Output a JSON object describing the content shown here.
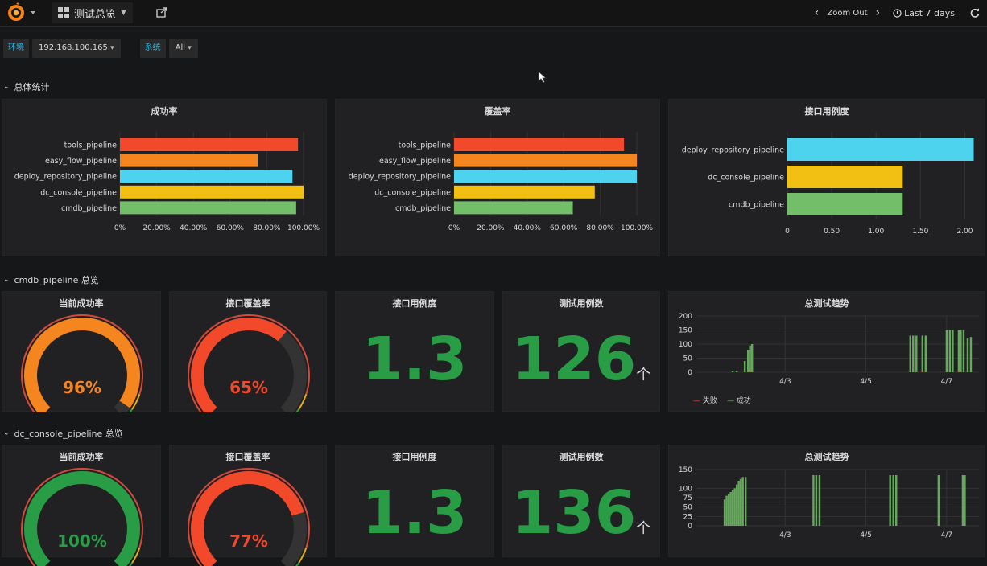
{
  "topbar": {
    "dashboard_title": "测试总览",
    "zoom_out_label": "Zoom Out",
    "time_range_label": "Last 7 days"
  },
  "variables": [
    {
      "label": "环境",
      "value": "192.168.100.165"
    },
    {
      "label": "系统",
      "value": "All"
    }
  ],
  "rows": [
    {
      "title": "总体统计"
    },
    {
      "title": "cmdb_pipeline 总览"
    },
    {
      "title": "dc_console_pipeline 总览"
    }
  ],
  "colors": {
    "red": "#f2492b",
    "orange": "#f5861f",
    "cyan": "#4dd3ee",
    "yellow": "#f2c012",
    "green": "#73bf69",
    "stat_green": "#299c46",
    "text_blue": "#33b5e5"
  },
  "bar_panels": [
    {
      "title": "成功率",
      "chart_data": {
        "type": "bar",
        "orientation": "horizontal",
        "categories": [
          "tools_pipeline",
          "easy_flow_pipeline",
          "deploy_repository_pipeline",
          "dc_console_pipeline",
          "cmdb_pipeline"
        ],
        "values": [
          97,
          75,
          94,
          100,
          96
        ],
        "colors": [
          "#f2492b",
          "#f5861f",
          "#4dd3ee",
          "#f2c012",
          "#73bf69"
        ],
        "xticks": [
          "0%",
          "20.00%",
          "40.00%",
          "60.00%",
          "80.00%",
          "100.00%"
        ],
        "xlim": [
          0,
          100
        ]
      }
    },
    {
      "title": "覆盖率",
      "chart_data": {
        "type": "bar",
        "orientation": "horizontal",
        "categories": [
          "tools_pipeline",
          "easy_flow_pipeline",
          "deploy_repository_pipeline",
          "dc_console_pipeline",
          "cmdb_pipeline"
        ],
        "values": [
          93,
          100,
          100,
          77,
          65
        ],
        "colors": [
          "#f2492b",
          "#f5861f",
          "#4dd3ee",
          "#f2c012",
          "#73bf69"
        ],
        "xticks": [
          "0%",
          "20.00%",
          "40.00%",
          "60.00%",
          "80.00%",
          "100.00%"
        ],
        "xlim": [
          0,
          100
        ]
      }
    },
    {
      "title": "接口用例度",
      "chart_data": {
        "type": "bar",
        "orientation": "horizontal",
        "categories": [
          "deploy_repository_pipeline",
          "dc_console_pipeline",
          "cmdb_pipeline"
        ],
        "values": [
          2.1,
          1.3,
          1.3
        ],
        "colors": [
          "#4dd3ee",
          "#f2c012",
          "#73bf69"
        ],
        "xticks": [
          "0",
          "0.50",
          "1.00",
          "1.50",
          "2.00"
        ],
        "xlim": [
          0,
          2.15
        ]
      }
    }
  ],
  "pipelines": [
    {
      "gauge1_title": "当前成功率",
      "gauge1_value": 96,
      "gauge1_text": "96%",
      "gauge1_color": "#f5861f",
      "gauge2_title": "接口覆盖率",
      "gauge2_value": 65,
      "gauge2_text": "65%",
      "gauge2_color": "#f2492b",
      "stat1_title": "接口用例度",
      "stat1_value": "1.3",
      "stat2_title": "测试用例数",
      "stat2_value": "126",
      "stat2_unit": "个",
      "trend_title": "总测试趋势",
      "trend_legend": [
        "失败",
        "成功"
      ],
      "chart_data": {
        "type": "bar",
        "yticks": [
          "200",
          "150",
          "100",
          "50",
          "0"
        ],
        "ylim": [
          0,
          200
        ],
        "xticks": [
          "4/3",
          "4/5",
          "4/7"
        ],
        "x_domain": [
          0,
          7
        ],
        "xtick_positions": [
          2.2,
          4.2,
          6.2
        ],
        "series": [
          {
            "name": "成功",
            "color": "#73bf69",
            "points": [
              [
                0.9,
                4
              ],
              [
                1.0,
                5
              ],
              [
                1.2,
                40
              ],
              [
                1.28,
                80
              ],
              [
                1.33,
                95
              ],
              [
                1.38,
                100
              ],
              [
                5.3,
                130
              ],
              [
                5.37,
                130
              ],
              [
                5.45,
                130
              ],
              [
                5.6,
                130
              ],
              [
                5.68,
                130
              ],
              [
                6.2,
                150
              ],
              [
                6.28,
                150
              ],
              [
                6.35,
                150
              ],
              [
                6.5,
                150
              ],
              [
                6.55,
                150
              ],
              [
                6.62,
                150
              ],
              [
                6.72,
                120
              ],
              [
                6.8,
                125
              ]
            ]
          },
          {
            "name": "失败",
            "color": "#f2492b",
            "points": [
              [
                1.33,
                2
              ],
              [
                5.6,
                2
              ],
              [
                6.5,
                2
              ]
            ]
          }
        ]
      }
    },
    {
      "gauge1_title": "当前成功率",
      "gauge1_value": 100,
      "gauge1_text": "100%",
      "gauge1_color": "#299c46",
      "gauge2_title": "接口覆盖率",
      "gauge2_value": 77,
      "gauge2_text": "77%",
      "gauge2_color": "#f2492b",
      "stat1_title": "接口用例度",
      "stat1_value": "1.3",
      "stat2_title": "测试用例数",
      "stat2_value": "136",
      "stat2_unit": "个",
      "trend_title": "总测试趋势",
      "chart_data": {
        "type": "bar",
        "yticks": [
          "150",
          "100",
          "75",
          "50",
          "25",
          "0"
        ],
        "ylim": [
          0,
          150
        ],
        "xticks": [
          "4/3",
          "4/5",
          "4/7"
        ],
        "x_domain": [
          0,
          7
        ],
        "xtick_positions": [
          2.2,
          4.2,
          6.2
        ],
        "series": [
          {
            "name": "成功",
            "color": "#73bf69",
            "points": [
              [
                0.7,
                70
              ],
              [
                0.75,
                80
              ],
              [
                0.8,
                85
              ],
              [
                0.85,
                90
              ],
              [
                0.9,
                95
              ],
              [
                0.95,
                100
              ],
              [
                1.0,
                110
              ],
              [
                1.05,
                120
              ],
              [
                1.1,
                125
              ],
              [
                1.15,
                130
              ],
              [
                1.22,
                130
              ],
              [
                2.9,
                135
              ],
              [
                2.97,
                135
              ],
              [
                3.05,
                135
              ],
              [
                4.8,
                135
              ],
              [
                4.88,
                135
              ],
              [
                4.95,
                135
              ],
              [
                6.0,
                135
              ],
              [
                6.6,
                135
              ],
              [
                6.65,
                135
              ]
            ]
          }
        ]
      }
    }
  ]
}
